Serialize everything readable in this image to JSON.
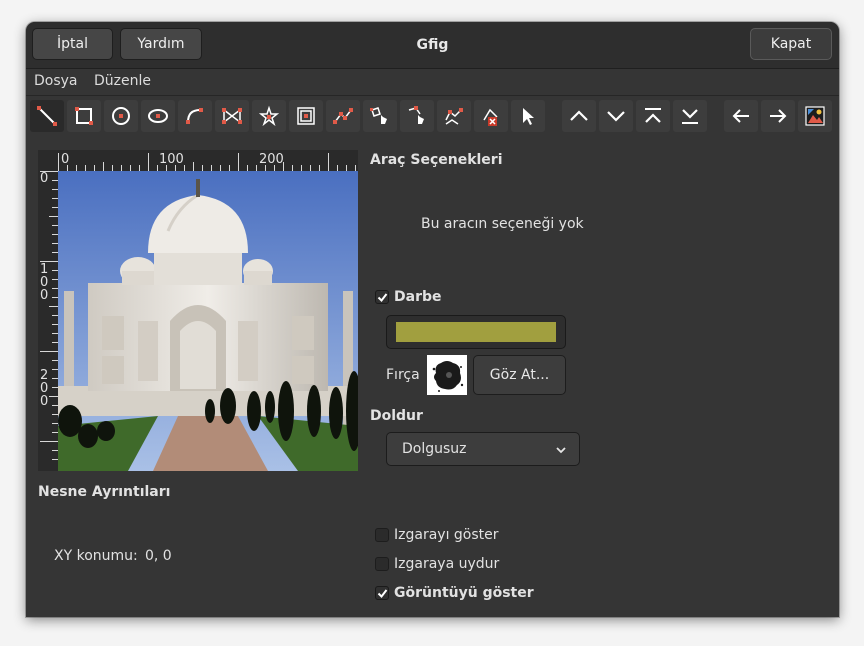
{
  "header": {
    "title": "Gfig",
    "cancel_label": "İptal",
    "help_label": "Yardım",
    "close_label": "Kapat"
  },
  "menubar": {
    "items": [
      "Dosya",
      "Düzenle"
    ]
  },
  "toolbar": {
    "tools": [
      "line-tool-icon",
      "rectangle-tool-icon",
      "circle-tool-icon",
      "ellipse-tool-icon",
      "arc-tool-icon",
      "polygon-tool-icon",
      "star-tool-icon",
      "spiral-tool-icon",
      "bezier-tool-icon",
      "move-object-icon",
      "move-point-icon",
      "copy-object-icon",
      "delete-object-icon",
      "select-pointer-icon"
    ],
    "order_tools": [
      "raise-icon",
      "lower-icon",
      "raise-to-top-icon",
      "lower-to-bottom-icon"
    ],
    "nav_tools": [
      "previous-icon",
      "next-icon",
      "show-all-icon"
    ]
  },
  "canvas": {
    "ruler_top_labels": [
      "0",
      "100",
      "200"
    ],
    "ruler_left_labels": [
      "0",
      "100",
      "200"
    ]
  },
  "tool_options": {
    "heading": "Araç Seçenekleri",
    "message": "Bu aracın seçeneği yok"
  },
  "stroke": {
    "label": "Darbe",
    "checked": true,
    "color": "#a19f3f",
    "brush_label": "Fırça",
    "browse_label": "Göz At..."
  },
  "fill": {
    "heading": "Doldur",
    "selected": "Dolgusuz"
  },
  "object_details": {
    "heading": "Nesne Ayrıntıları",
    "xy_label": "XY konumu:",
    "xy_value": "0, 0"
  },
  "options": {
    "show_grid": {
      "label": "Izgarayı göster",
      "checked": false
    },
    "snap_to_grid": {
      "label": "Izgaraya uydur",
      "checked": false
    },
    "show_image": {
      "label": "Görüntüyü göster",
      "checked": true
    }
  },
  "colors": {
    "window_bg": "#353535",
    "header_bg": "#2e2e2e",
    "tool_button_bg": "#3d3d3d",
    "icon_color": "#ffffff",
    "accent_red": "#e05a48"
  }
}
